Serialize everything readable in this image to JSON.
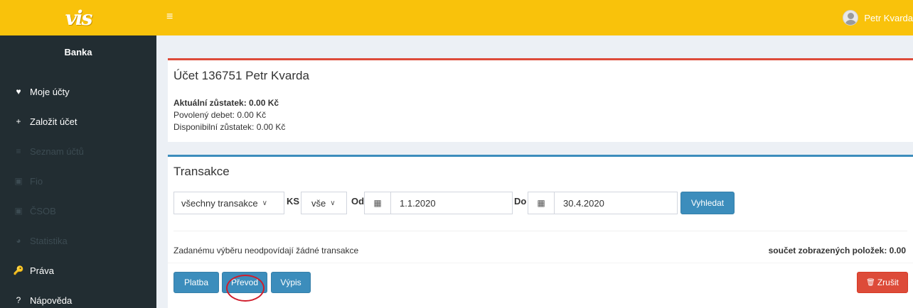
{
  "logo": {
    "text": "vis"
  },
  "sidebar": {
    "heading": "Banka",
    "items": [
      {
        "label": "Moje účty",
        "icon": "heart-icon",
        "glyph": "♥",
        "enabled": true
      },
      {
        "label": "Založit účet",
        "icon": "plus-icon",
        "glyph": "+",
        "enabled": true
      },
      {
        "label": "Seznam účtů",
        "icon": "list-icon",
        "glyph": "≡",
        "enabled": false
      },
      {
        "label": "Fio",
        "icon": "money-icon",
        "glyph": "▣",
        "enabled": false
      },
      {
        "label": "ČSOB",
        "icon": "money-icon",
        "glyph": "▣",
        "enabled": false
      },
      {
        "label": "Statistika",
        "icon": "pie-chart-icon",
        "glyph": "◕",
        "enabled": false
      },
      {
        "label": "Práva",
        "icon": "key-icon",
        "glyph": "🔑",
        "enabled": true
      },
      {
        "label": "Nápověda",
        "icon": "question-icon",
        "glyph": "?",
        "enabled": true
      }
    ]
  },
  "topbar": {
    "menu_glyph": "≡",
    "user_name": "Petr Kvarda"
  },
  "account": {
    "title": "Účet 136751 Petr Kvarda",
    "balance": "Aktuální zůstatek: 0.00 Kč",
    "overdraft": "Povolený debet: 0.00 Kč",
    "available": "Disponibilní zůstatek: 0.00 Kč"
  },
  "transactions": {
    "title": "Transakce",
    "type_select": "všechny transakce",
    "ks_label": "KS",
    "ks_select": "vše",
    "from_label": "Od",
    "from_value": "1.1.2020",
    "to_label": "Do",
    "to_value": "30.4.2020",
    "search_button": "Vyhledat",
    "empty_message": "Zadanému výběru neodpovídají žádné transakce",
    "sum_label": "součet zobrazených položek: 0.00",
    "calendar_glyph": "▦",
    "chevron_glyph": "∨"
  },
  "actions": {
    "payment": "Platba",
    "transfer": "Převod",
    "statement": "Výpis",
    "cancel": "Zrušit",
    "cancel_glyph": "🗑"
  },
  "colors": {
    "accent_yellow": "#f9c20b",
    "sidebar_bg": "#222d32",
    "primary_blue": "#3c8dbc",
    "danger_red": "#dd4b39",
    "highlight_circle": "#d01c2b"
  }
}
